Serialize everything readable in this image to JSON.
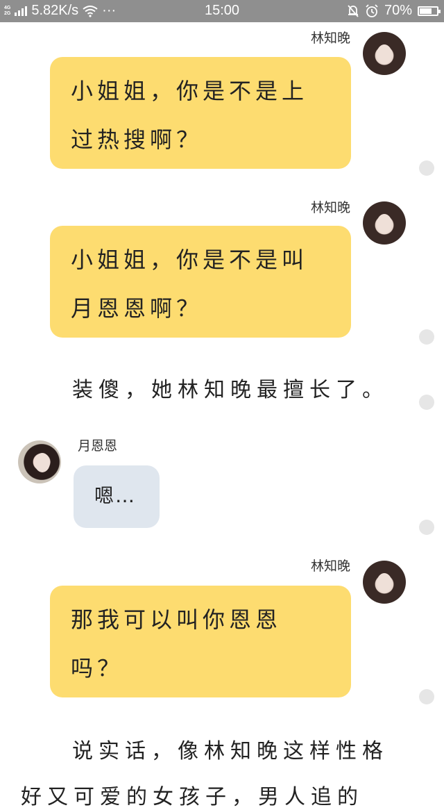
{
  "status_bar": {
    "network_top": "4G",
    "network_bottom": "2G",
    "speed": "5.82K/s",
    "more": "···",
    "time": "15:00",
    "battery_percent": "70%",
    "battery_level": 0.7
  },
  "messages": [
    {
      "sender": "林知晚",
      "side": "right",
      "lines": [
        "小姐姐，你是不是上",
        "过热搜啊？"
      ]
    },
    {
      "sender": "林知晚",
      "side": "right",
      "lines": [
        "小姐姐，你是不是叫",
        "月恩恩啊？"
      ]
    },
    {
      "sender": "月恩恩",
      "side": "left",
      "lines": [
        "嗯…"
      ]
    },
    {
      "sender": "林知晚",
      "side": "right",
      "lines": [
        "那我可以叫你恩恩",
        "吗？"
      ]
    }
  ],
  "narration": [
    "装傻，她林知晚最擅长了。",
    "说实话，像林知晚这样性格",
    "好又可爱的女孩子，男人追的"
  ],
  "colors": {
    "status_bar": "#8f8f8f",
    "right_bubble": "#fddc70",
    "left_bubble": "#dfe6ee"
  }
}
